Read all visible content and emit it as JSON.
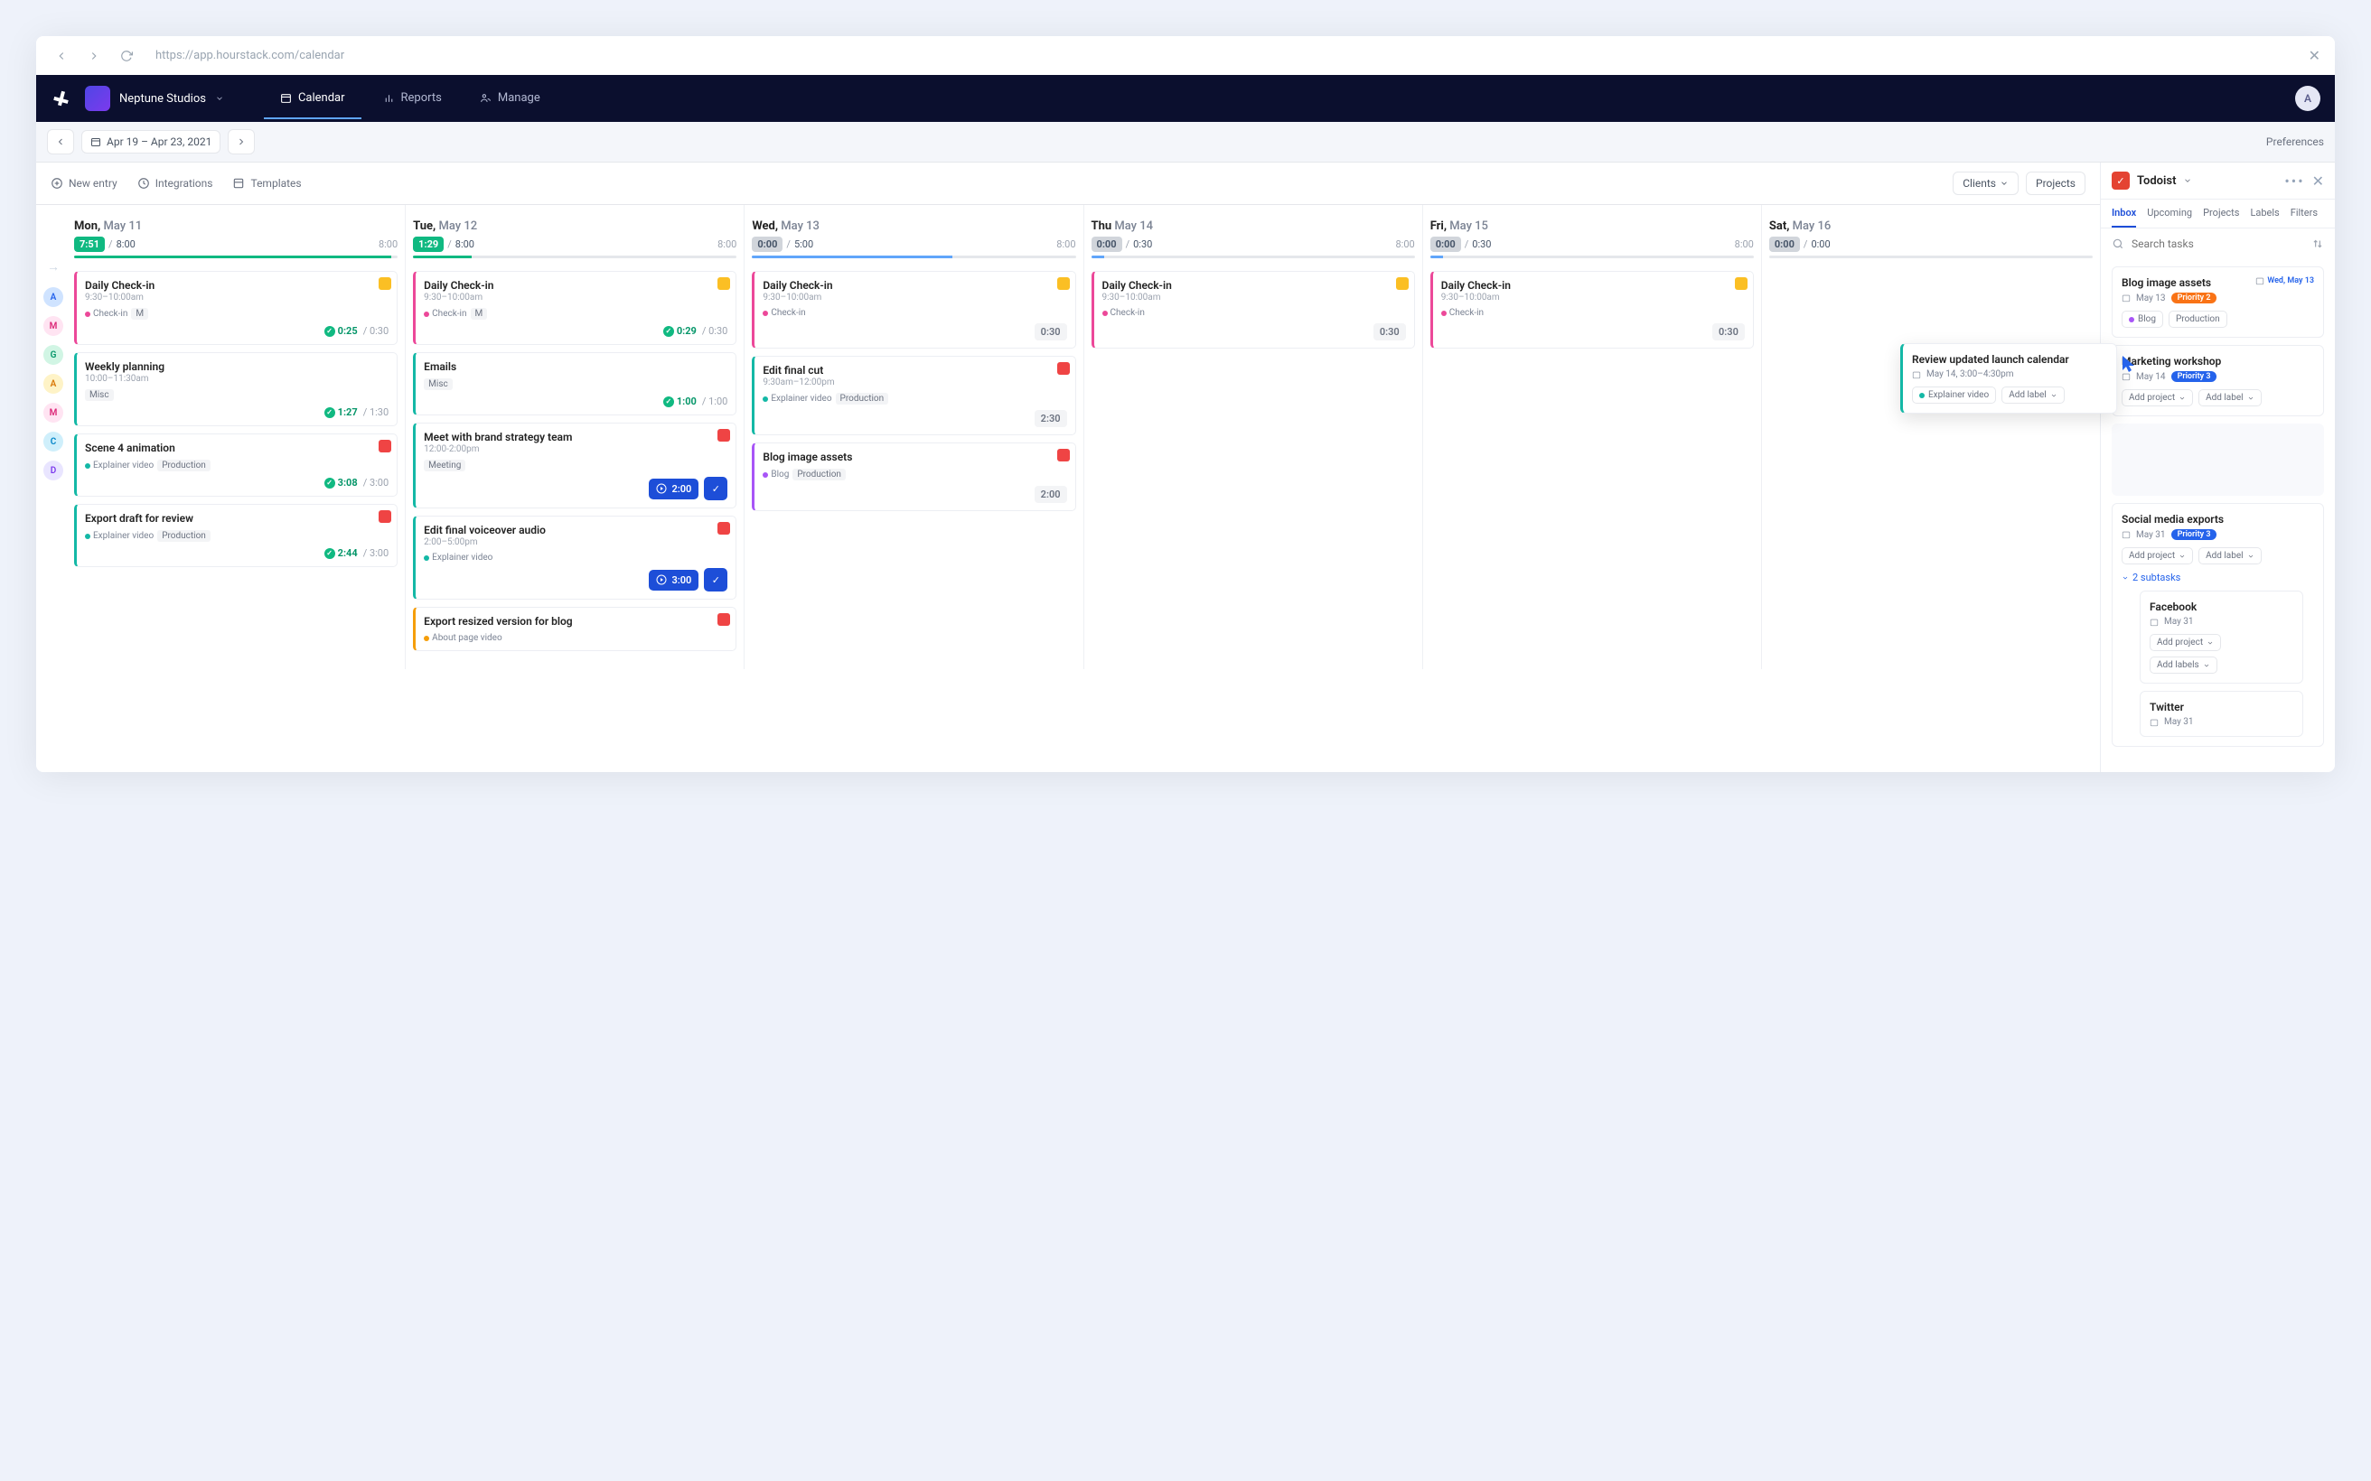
{
  "browser": {
    "url": "https://app.hourstack.com/calendar"
  },
  "header": {
    "workspace": "Neptune Studios",
    "avatar": "A",
    "tabs": [
      "Calendar",
      "Reports",
      "Manage"
    ]
  },
  "toolbar": {
    "dateRange": "Apr 19 – Apr 23, 2021",
    "preferences": "Preferences"
  },
  "actions": {
    "newEntry": "New entry",
    "integrations": "Integrations",
    "templates": "Templates",
    "clients": "Clients",
    "projects": "Projects"
  },
  "avatars": [
    {
      "letter": "A",
      "bg": "#cfe3ff",
      "color": "#2563eb"
    },
    {
      "letter": "M",
      "bg": "#ffe4f2",
      "color": "#db2777"
    },
    {
      "letter": "G",
      "bg": "#d1f5e4",
      "color": "#059669"
    },
    {
      "letter": "A",
      "bg": "#fef3c7",
      "color": "#d97706"
    },
    {
      "letter": "M",
      "bg": "#ffe4f2",
      "color": "#db2777"
    },
    {
      "letter": "C",
      "bg": "#cfeffb",
      "color": "#0284c7"
    },
    {
      "letter": "D",
      "bg": "#e9e5ff",
      "color": "#7c3aed"
    }
  ],
  "days": [
    {
      "name": "Mon,",
      "date": " May 11",
      "pill": "7:51",
      "base": "8:00",
      "right": "8:00",
      "pillClass": "",
      "fill": 98,
      "color": "#10b981",
      "cards": [
        {
          "t": "Daily Check-in",
          "sub": "9:30–10:00am",
          "icon": "#fbbf24",
          "left": "#ec4899",
          "tags": [
            {
              "d": "#ec4899",
              "t": "Check-in"
            }
          ],
          "labels": [
            "M"
          ],
          "status": "0:25",
          "dur": "0:30"
        },
        {
          "t": "Weekly planning",
          "sub": "10:00–11:30am",
          "left": "#14b8a6",
          "labels": [
            "Misc"
          ],
          "status": "1:27",
          "dur": "1:30"
        },
        {
          "t": "Scene 4 animation",
          "icon": "#ef4444",
          "left": "#14b8a6",
          "tags": [
            {
              "d": "#14b8a6",
              "t": "Explainer video"
            }
          ],
          "labels": [
            "Production"
          ],
          "status": "3:08",
          "dur": "3:00"
        },
        {
          "t": "Export draft for review",
          "icon": "#ef4444",
          "left": "#14b8a6",
          "tags": [
            {
              "d": "#14b8a6",
              "t": "Explainer video"
            }
          ],
          "labels": [
            "Production"
          ],
          "status": "2:44",
          "dur": "3:00"
        }
      ]
    },
    {
      "name": "Tue,",
      "date": " May 12",
      "pill": "1:29",
      "base": "8:00",
      "right": "8:00",
      "pillClass": "",
      "fill": 18,
      "color": "#10b981",
      "cards": [
        {
          "t": "Daily Check-in",
          "sub": "9:30–10:00am",
          "icon": "#fbbf24",
          "left": "#ec4899",
          "tags": [
            {
              "d": "#ec4899",
              "t": "Check-in"
            }
          ],
          "labels": [
            "M"
          ],
          "status": "0:29",
          "dur": "0:30"
        },
        {
          "t": "Emails",
          "left": "#14b8a6",
          "labels": [
            "Misc"
          ],
          "status": "1:00",
          "dur": "1:00"
        },
        {
          "t": "Meet with brand strategy team",
          "sub": "12:00-2:00pm",
          "icon": "#ef4444",
          "left": "#14b8a6",
          "labels": [
            "Meeting"
          ],
          "play": "2:00"
        },
        {
          "t": "Edit final voiceover audio",
          "sub": "2:00–5:00pm",
          "icon": "#ef4444",
          "left": "#14b8a6",
          "tags": [
            {
              "d": "#14b8a6",
              "t": "Explainer video"
            }
          ],
          "play": "3:00"
        },
        {
          "t": "Export resized version for blog",
          "icon": "#ef4444",
          "left": "#f59e0b",
          "tags": [
            {
              "d": "#f59e0b",
              "t": "About page video"
            }
          ]
        }
      ]
    },
    {
      "name": "Wed,",
      "date": " May 13",
      "pill": "0:00",
      "base": "5:00",
      "right": "8:00",
      "pillClass": "gray",
      "fill": 62,
      "color": "#60a5fa",
      "cards": [
        {
          "t": "Daily Check-in",
          "sub": "9:30–10:00am",
          "icon": "#fbbf24",
          "left": "#ec4899",
          "tags": [
            {
              "d": "#ec4899",
              "t": "Check-in"
            }
          ],
          "durbox": "0:30"
        },
        {
          "t": "Edit final cut",
          "sub": "9:30am–12:00pm",
          "icon": "#ef4444",
          "left": "#14b8a6",
          "tags": [
            {
              "d": "#14b8a6",
              "t": "Explainer video"
            }
          ],
          "labels": [
            "Production"
          ],
          "durbox": "2:30"
        },
        {
          "t": "Blog image assets",
          "icon": "#ef4444",
          "left": "#a855f7",
          "tags": [
            {
              "d": "#a855f7",
              "t": "Blog"
            }
          ],
          "labels": [
            "Production"
          ],
          "durbox": "2:00"
        }
      ]
    },
    {
      "name": "Thu",
      "date": " May 14",
      "pill": "0:00",
      "base": "0:30",
      "right": "8:00",
      "pillClass": "gray",
      "fill": 4,
      "color": "#60a5fa",
      "cards": [
        {
          "t": "Daily Check-in",
          "sub": "9:30–10:00am",
          "icon": "#fbbf24",
          "left": "#ec4899",
          "tags": [
            {
              "d": "#ec4899",
              "t": "Check-in"
            }
          ],
          "durbox": "0:30"
        }
      ]
    },
    {
      "name": "Fri,",
      "date": " May 15",
      "pill": "0:00",
      "base": "0:30",
      "right": "8:00",
      "pillClass": "gray",
      "fill": 4,
      "color": "#60a5fa",
      "cards": [
        {
          "t": "Daily Check-in",
          "sub": "9:30–10:00am",
          "icon": "#fbbf24",
          "left": "#ec4899",
          "tags": [
            {
              "d": "#ec4899",
              "t": "Check-in"
            }
          ],
          "durbox": "0:30"
        }
      ]
    },
    {
      "name": "Sat,",
      "date": " May 16",
      "pill": "0:00",
      "base": "0:00",
      "pillClass": "gray",
      "fill": 0,
      "color": "#60a5fa",
      "cards": []
    }
  ],
  "float": {
    "title": "Review updated launch calendar",
    "meta": "May 14, 3:00–4:30pm",
    "tag": "Explainer video",
    "addLabel": "Add label"
  },
  "sidebar": {
    "title": "Todoist",
    "tabs": [
      "Inbox",
      "Upcoming",
      "Projects",
      "Labels",
      "Filters"
    ],
    "search": "Search tasks",
    "items": [
      {
        "title": "Blog image assets",
        "date": "May 13",
        "priority": "Priority 2",
        "pClass": "p2",
        "dateChip": "Wed, May 13",
        "chips": [
          {
            "t": "Blog",
            "d": "#a855f7"
          },
          {
            "t": "Production"
          }
        ]
      },
      {
        "title": "Marketing workshop",
        "date": "May 14",
        "priority": "Priority 3",
        "pClass": "p3",
        "chips": [
          {
            "t": "Add project",
            "drop": true
          },
          {
            "t": "Add label",
            "drop": true
          }
        ]
      }
    ],
    "items2": [
      {
        "title": "Social media exports",
        "date": "May 31",
        "priority": "Priority 3",
        "pClass": "p3",
        "chips": [
          {
            "t": "Add project",
            "drop": true
          },
          {
            "t": "Add label",
            "drop": true
          }
        ],
        "subtaskLabel": "2 subtasks",
        "subs": [
          {
            "title": "Facebook",
            "date": "May 31",
            "chips": [
              {
                "t": "Add project",
                "drop": true
              },
              {
                "t": "Add labels",
                "drop": true
              }
            ]
          },
          {
            "title": "Twitter",
            "date": "May 31"
          }
        ]
      }
    ]
  }
}
